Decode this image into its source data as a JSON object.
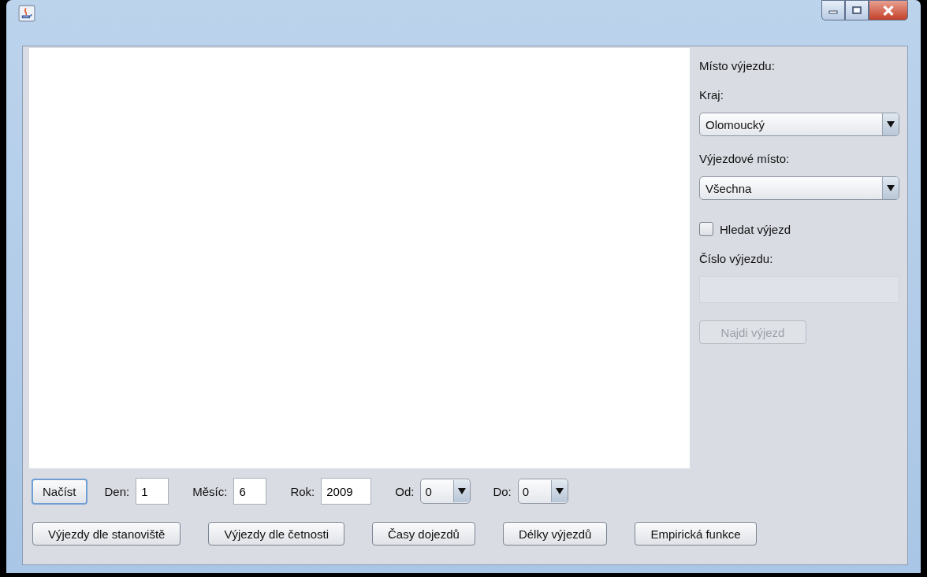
{
  "side_panel": {
    "heading": "Místo výjezdu:",
    "region_label": "Kraj:",
    "region_combo": {
      "value": "Olomoucký"
    },
    "station_label": "Výjezdové místo:",
    "station_combo": {
      "value": "Všechna"
    },
    "search_checkbox": {
      "label": "Hledat výjezd",
      "checked": false
    },
    "number_label": "Číslo výjezdu:",
    "number_field": {
      "disabled": true
    },
    "find_button": {
      "label": "Najdi výjezd",
      "disabled": true
    }
  },
  "load_button": "Načíst",
  "date_fields": [
    {
      "label": "Den:",
      "value": "1"
    },
    {
      "label": "Měsíc:",
      "value": "6"
    },
    {
      "label": "Rok:",
      "value": "2009"
    }
  ],
  "hour_combos": [
    {
      "label": "Od:",
      "value": "0"
    },
    {
      "label": "Do:",
      "value": "0"
    }
  ],
  "buttons": [
    "Výjezdy dle stanoviště",
    "Výjezdy dle četnosti",
    "Časy dojezdů",
    "Délky výjezdů",
    "Empirická funkce"
  ]
}
